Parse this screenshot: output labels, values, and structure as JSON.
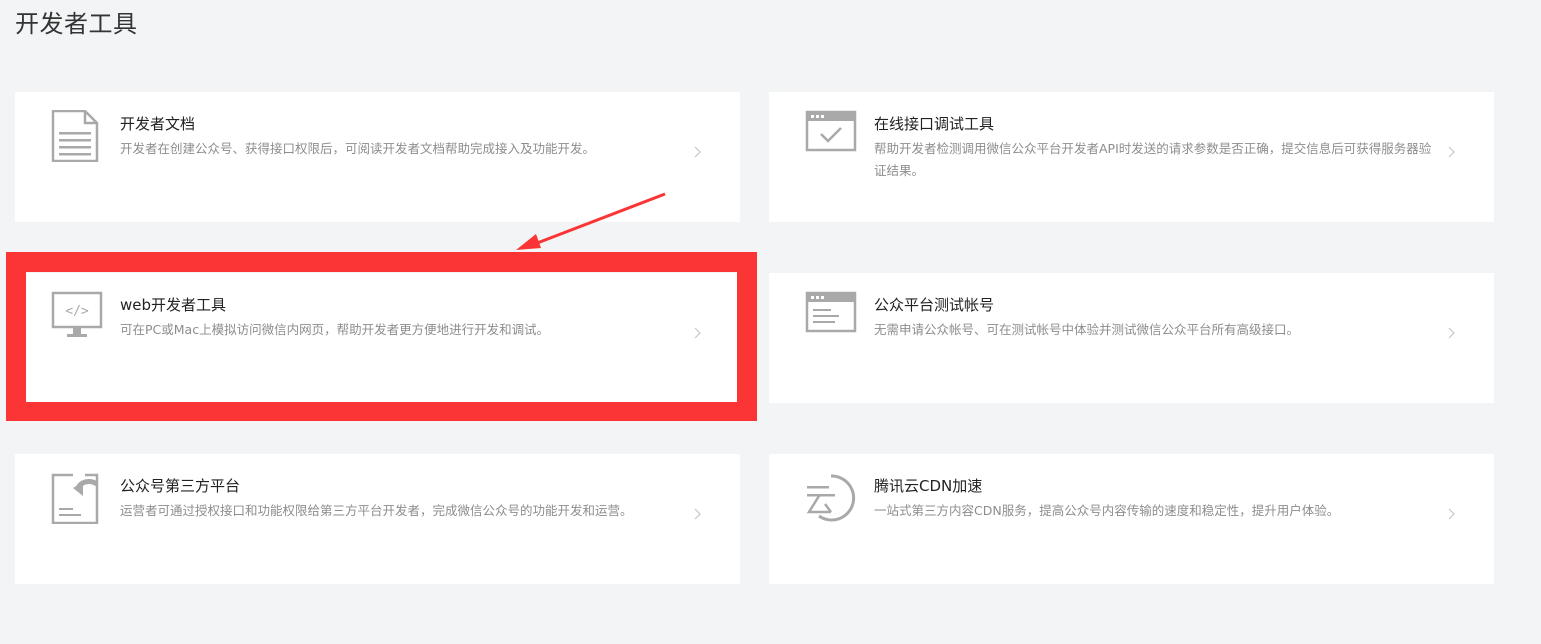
{
  "page": {
    "title": "开发者工具"
  },
  "cards": [
    {
      "id": "dev-docs",
      "title": "开发者文档",
      "desc": "开发者在创建公众号、获得接口权限后，可阅读开发者文档帮助完成接入及功能开发。",
      "icon": "document-icon"
    },
    {
      "id": "api-debug",
      "title": "在线接口调试工具",
      "desc": "帮助开发者检测调用微信公众平台开发者API时发送的请求参数是否正确，提交信息后可获得服务器验证结果。",
      "icon": "browser-check-icon"
    },
    {
      "id": "web-devtools",
      "title": "web开发者工具",
      "desc": "可在PC或Mac上模拟访问微信内网页，帮助开发者更方便地进行开发和调试。",
      "icon": "monitor-code-icon"
    },
    {
      "id": "test-account",
      "title": "公众平台测试帐号",
      "desc": "无需申请公众帐号、可在测试帐号中体验并测试微信公众平台所有高级接口。",
      "icon": "browser-window-icon"
    },
    {
      "id": "third-party",
      "title": "公众号第三方平台",
      "desc": "运营者可通过授权接口和功能权限给第三方平台开发者，完成微信公众号的功能开发和运营。",
      "icon": "document-share-icon"
    },
    {
      "id": "cdn",
      "title": "腾讯云CDN加速",
      "desc": "一站式第三方内容CDN服务，提高公众号内容传输的速度和稳定性，提升用户体验。",
      "icon": "tencent-cloud-icon"
    }
  ],
  "colors": {
    "background": "#f3f4f6",
    "card": "#ffffff",
    "icon": "#a9a9a9",
    "highlight": "#fb3535"
  }
}
